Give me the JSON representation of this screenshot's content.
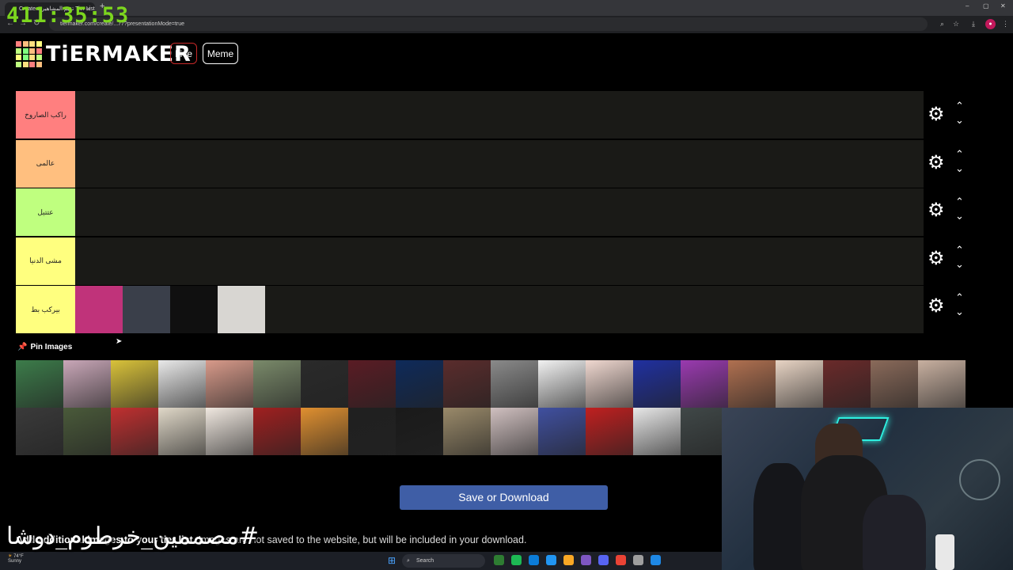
{
  "browser": {
    "tab_title": "Create a تقيم المشاهير Tier List",
    "url": "tiermaker.com/create/...77?presentationMode=true",
    "new_tab": "+",
    "minimize": "–",
    "maximize": "▢",
    "close": "✕"
  },
  "stream_timer": "411:35:53",
  "header": {
    "logo_text": "TiERMAKER",
    "live_label": "Live",
    "meme_label": "Meme",
    "logo_colors": [
      "#ff7f7f",
      "#ffbf7f",
      "#ffdf7f",
      "#ffff7f",
      "#bfff7f",
      "#7fff7f",
      "#ffbf7f",
      "#ff7f7f",
      "#ffff7f",
      "#7fff7f",
      "#ffdf7f",
      "#bfff7f",
      "#bfff7f",
      "#ffdf7f",
      "#ff7f7f",
      "#ffbf7f"
    ]
  },
  "tiers": [
    {
      "label": "راكب الصاروخ",
      "color": "#ff7f7f",
      "items": []
    },
    {
      "label": "عالمى",
      "color": "#ffbf7f",
      "items": []
    },
    {
      "label": "عتتيل",
      "color": "#bfff7f",
      "items": []
    },
    {
      "label": "مشى الدنيا",
      "color": "#ffff7f",
      "items": []
    },
    {
      "label": "بيركب بط",
      "color": "#ffff7f",
      "items": [
        "#c0337a",
        "#3a3f4a",
        "#101010",
        "#d8d6d2"
      ]
    }
  ],
  "tier_controls": {
    "gear": "⚙",
    "up": "⌃",
    "down": "⌄"
  },
  "pin_images_label": "Pin Images",
  "pool_images": [
    "#3c7c4a",
    "#c9a7b8",
    "#d9c23a",
    "#e9e9e9",
    "#d89a8a",
    "#7a8a6a",
    "#2a2a2a",
    "#5a1c24",
    "#0e2a5a",
    "#5a2c2c",
    "#8a8a8a",
    "#f2f2f2",
    "#f0d8d0",
    "#2030a0",
    "#9a3ab0",
    "#b07050",
    "#e8d4c4",
    "#6a2a2a",
    "#8a6a5a",
    "#c8b0a0",
    "#3a3a3a",
    "#4a5a3a",
    "#c03030",
    "#e0d8c8",
    "#f0e8e0",
    "#a02020",
    "#e09030",
    "#202020",
    "#1a1a1a",
    "#9a8a6a",
    "#d0c0c0",
    "#4050a0",
    "#c02020",
    "#e8e8e8",
    "#404848"
  ],
  "save_button": "Save or Download",
  "add_info_bold": "Add additional images to your tier list.",
  "add_info_rest": " Images are not saved to the website, but will be included in your download.",
  "watermark": "#مصممين_خرطوم_دوشا",
  "taskbar": {
    "weather_temp": "74°F",
    "weather_desc": "Sunny",
    "search_label": "Search",
    "app_colors": [
      "#2e7d32",
      "#1db954",
      "#0b7cd8",
      "#2196f3",
      "#f9a825",
      "#7e57c2",
      "#5865f2",
      "#ea4335",
      "#9e9e9e",
      "#1e88e5"
    ]
  }
}
